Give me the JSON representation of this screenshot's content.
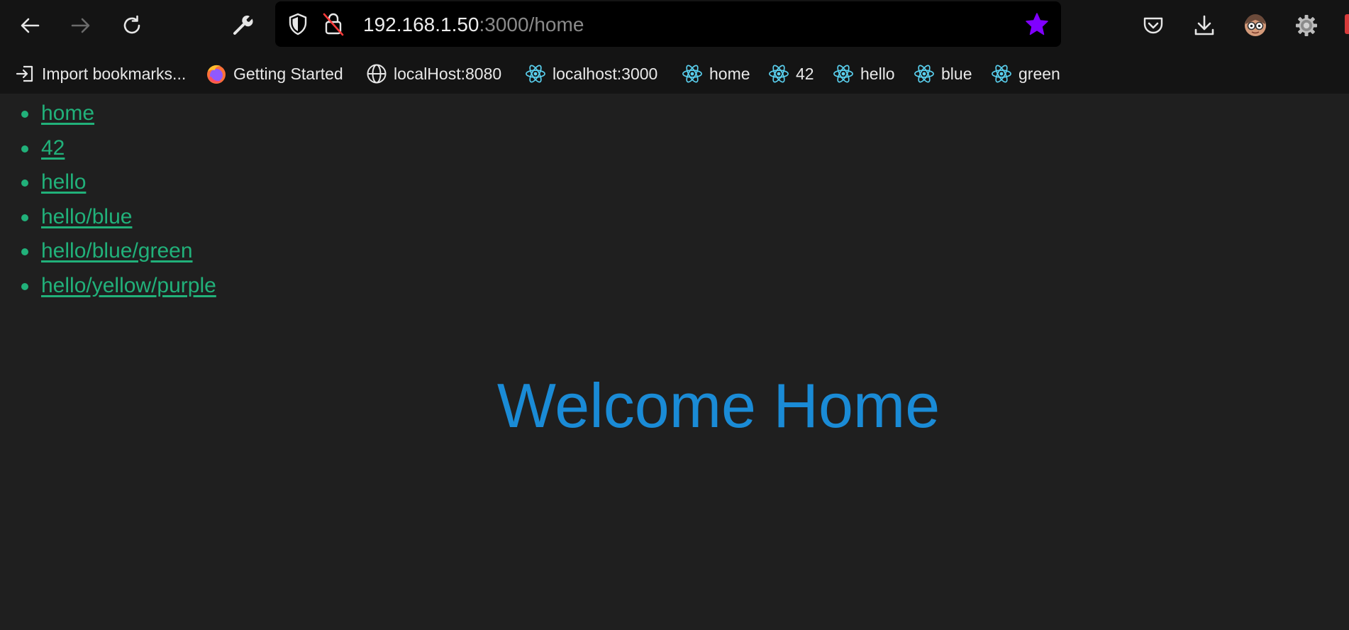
{
  "browser": {
    "url_host": "192.168.1.50",
    "url_path": ":3000/home",
    "bookmark_star_color": "#8000ff",
    "toolbar_icons": [
      "back-icon",
      "forward-icon",
      "reload-icon",
      "wrench-icon",
      "shield-icon",
      "insecure-lock-icon",
      "bookmark-star-icon",
      "pocket-icon",
      "download-icon",
      "profile-avatar-icon",
      "settings-gear-icon"
    ],
    "bookmarks": [
      {
        "label": "Import bookmarks...",
        "icon": "import-icon"
      },
      {
        "label": "Getting Started",
        "icon": "firefox-icon"
      },
      {
        "label": "localHost:8080",
        "icon": "globe-icon"
      },
      {
        "label": "localhost:3000",
        "icon": "react-icon"
      },
      {
        "label": "home",
        "icon": "react-icon"
      },
      {
        "label": "42",
        "icon": "react-icon"
      },
      {
        "label": "hello",
        "icon": "react-icon"
      },
      {
        "label": "blue",
        "icon": "react-icon"
      },
      {
        "label": "green",
        "icon": "react-icon"
      }
    ]
  },
  "page": {
    "nav_links": [
      "home",
      "42",
      "hello",
      "hello/blue",
      "hello/blue/green",
      "hello/yellow/purple"
    ],
    "heading": "Welcome Home",
    "link_color": "#21b17a",
    "heading_color": "#1a8bd6",
    "background_color": "#1f1f1f"
  }
}
